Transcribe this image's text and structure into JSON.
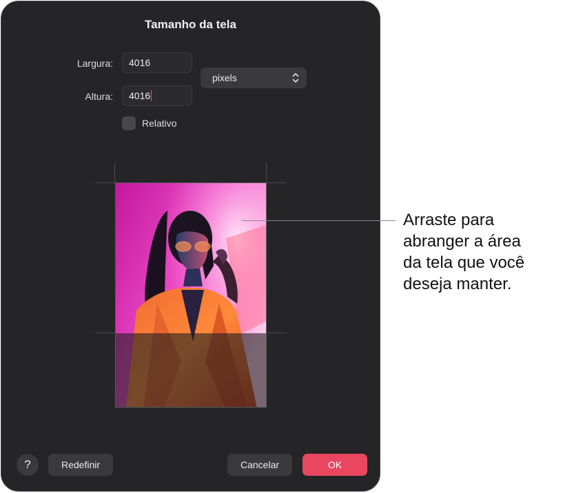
{
  "dialog": {
    "title": "Tamanho da tela",
    "width_label": "Largura:",
    "width_value": "4016",
    "height_label": "Altura:",
    "height_value": "4016",
    "unit_select": "pixels",
    "relative_label": "Relativo",
    "relative_checked": false
  },
  "footer": {
    "help_label": "?",
    "reset_label": "Redefinir",
    "cancel_label": "Cancelar",
    "ok_label": "OK",
    "ok_color": "#e9475f"
  },
  "callout": {
    "lines": [
      "Arraste para",
      "abranger a área",
      "da tela que você",
      "deseja manter."
    ]
  }
}
